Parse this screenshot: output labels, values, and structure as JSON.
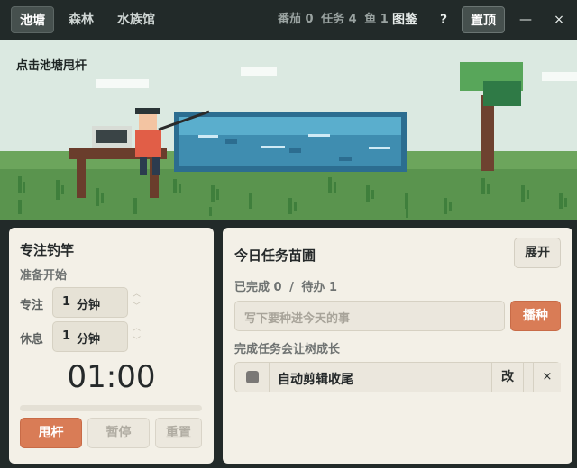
{
  "nav": {
    "tabs": [
      {
        "label": "池塘",
        "active": true
      },
      {
        "label": "森林",
        "active": false
      },
      {
        "label": "水族馆",
        "active": false
      }
    ]
  },
  "stats": {
    "tomato_label": "番茄",
    "tomato_count": "0",
    "task_label": "任务",
    "task_count": "4",
    "fish_label": "鱼",
    "fish_count": "1"
  },
  "toolbar": {
    "catalog_label": "图鉴",
    "help_label": "?",
    "pin_label": "置顶",
    "minimize_label": "—",
    "close_label": "×"
  },
  "scene": {
    "hint": "点击池塘甩杆"
  },
  "focus": {
    "title": "专注钓竿",
    "status": "准备开始",
    "focus_label": "专注",
    "focus_value": "1",
    "focus_unit": "分钟",
    "rest_label": "休息",
    "rest_value": "1",
    "rest_unit": "分钟",
    "timer": "01:00",
    "progress": 0,
    "cast_label": "甩杆",
    "pause_label": "暂停",
    "reset_label": "重置"
  },
  "tasks": {
    "title": "今日任务苗圃",
    "expand_label": "展开",
    "done_label": "已完成",
    "done_count": "0",
    "separator": "/",
    "todo_label": "待办",
    "todo_count": "1",
    "input_placeholder": "写下要种进今天的事",
    "plant_label": "播种",
    "tip": "完成任务会让树成长",
    "items": [
      {
        "text": "自动剪辑收尾",
        "done": false,
        "edit_label": "改",
        "delete_label": "×"
      }
    ]
  },
  "colors": {
    "accent": "#d97c56",
    "sky": "#dbe9e1",
    "grass": "#5a944e",
    "water": "#3f8db0"
  }
}
